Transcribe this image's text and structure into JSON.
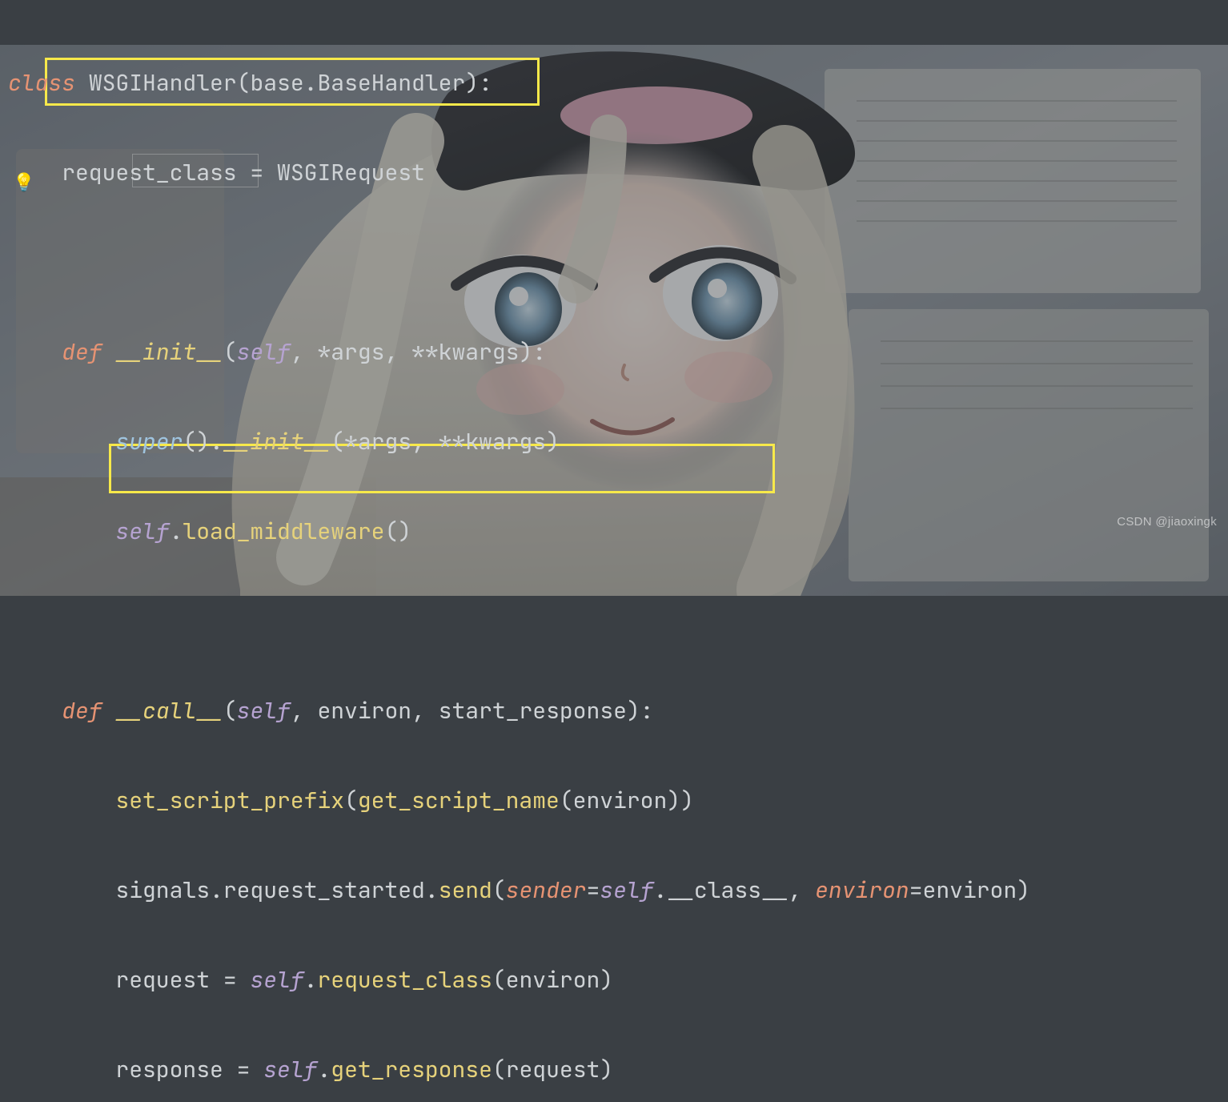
{
  "kw_class": "class",
  "cls_name": "WSGIHandler",
  "base_mod": "base",
  "base_cls": "BaseHandler",
  "attr_name": "request_class",
  "attr_val": "WSGIRequest",
  "kw_def": "def",
  "init_name": "__init__",
  "p_self": "self",
  "p_args": "args",
  "p_kwargs": "kwargs",
  "p_environ": "environ",
  "p_start_response": "start_response",
  "super_call": "super",
  "dunder_init": "__init__",
  "load_mw": "load_middleware",
  "call_name": "__call__",
  "set_prefix": "set_script_prefix",
  "get_name": "get_script_name",
  "signals": "signals",
  "req_started": "request_started",
  "send": "send",
  "kw_sender": "sender",
  "dunder_class": "__class__",
  "kw_environ": "environ",
  "request_var": "request",
  "request_class_attr": "request_class",
  "response_var": "response",
  "get_response": "get_response",
  "watermark": "CSDN @jiaoxingk"
}
